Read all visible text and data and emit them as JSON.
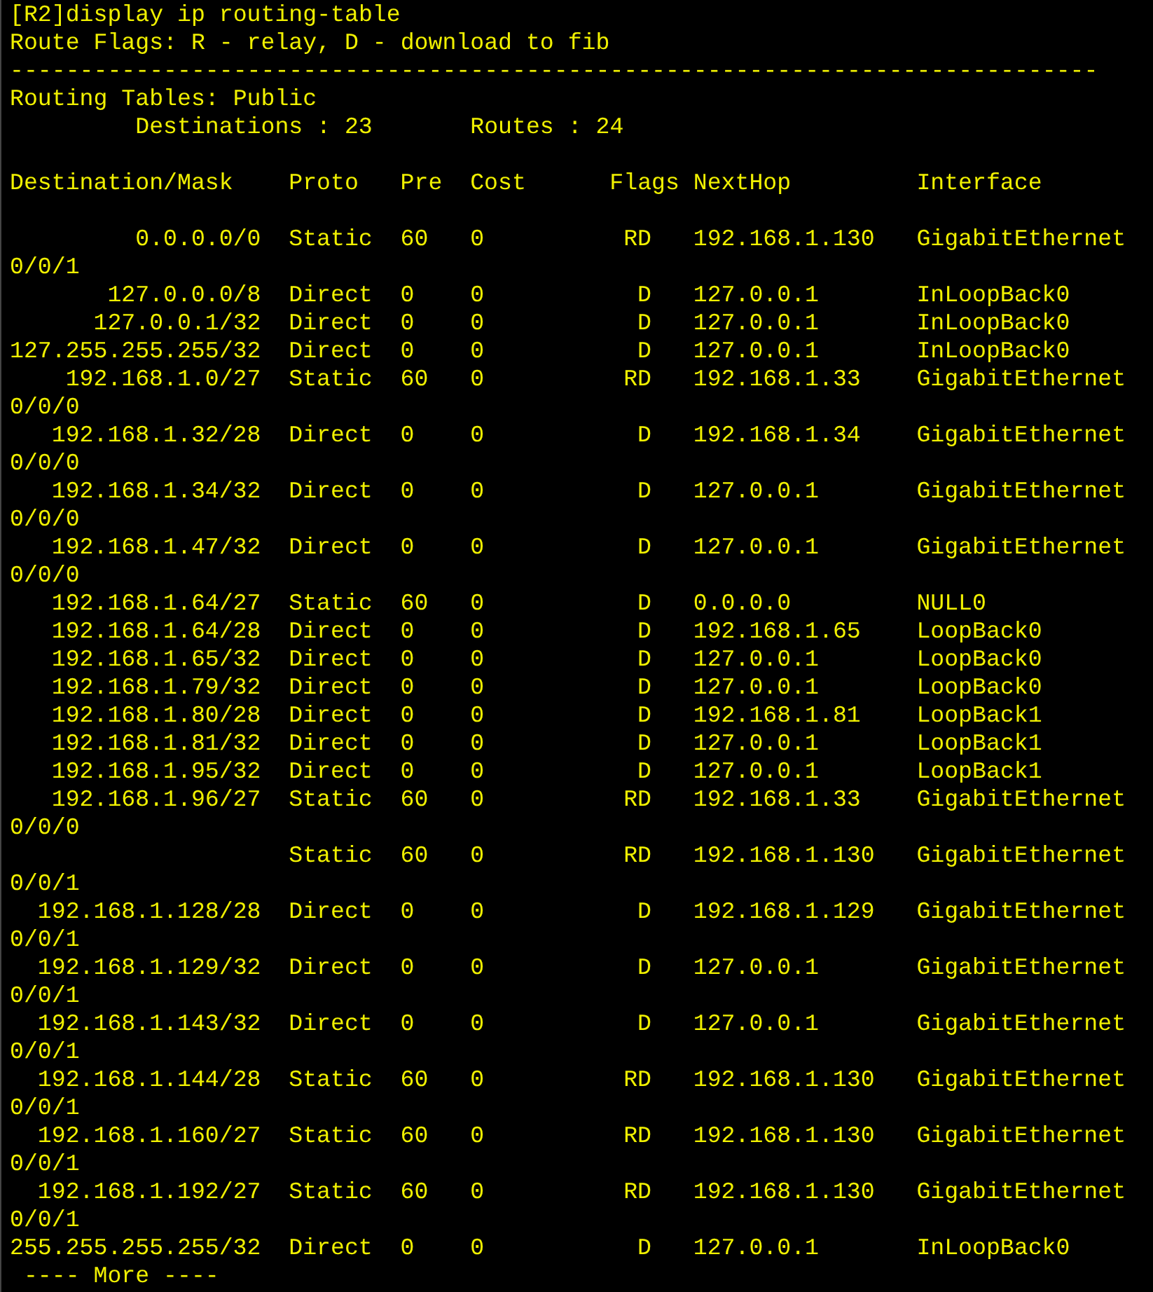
{
  "command": "[R2]display ip routing-table",
  "route_flags": "Route Flags: R - relay, D - download to fib",
  "separator": "------------------------------------------------------------------------------",
  "table_title": "Routing Tables: Public",
  "summary": {
    "destinations_label": "Destinations : 23",
    "routes_label": "Routes : 24"
  },
  "columns": [
    "Destination/Mask",
    "Proto",
    "Pre",
    "Cost",
    "Flags",
    "NextHop",
    "Interface"
  ],
  "rows": [
    {
      "destination": "0.0.0.0/0",
      "proto": "Static",
      "pre": "60",
      "cost": "0",
      "flags": "RD",
      "nexthop": "192.168.1.130",
      "interface": "GigabitEthernet",
      "interface_wrap": "0/0/1"
    },
    {
      "destination": "127.0.0.0/8",
      "proto": "Direct",
      "pre": "0",
      "cost": "0",
      "flags": "D",
      "nexthop": "127.0.0.1",
      "interface": "InLoopBack0"
    },
    {
      "destination": "127.0.0.1/32",
      "proto": "Direct",
      "pre": "0",
      "cost": "0",
      "flags": "D",
      "nexthop": "127.0.0.1",
      "interface": "InLoopBack0"
    },
    {
      "destination": "127.255.255.255/32",
      "proto": "Direct",
      "pre": "0",
      "cost": "0",
      "flags": "D",
      "nexthop": "127.0.0.1",
      "interface": "InLoopBack0"
    },
    {
      "destination": "192.168.1.0/27",
      "proto": "Static",
      "pre": "60",
      "cost": "0",
      "flags": "RD",
      "nexthop": "192.168.1.33",
      "interface": "GigabitEthernet",
      "interface_wrap": "0/0/0"
    },
    {
      "destination": "192.168.1.32/28",
      "proto": "Direct",
      "pre": "0",
      "cost": "0",
      "flags": "D",
      "nexthop": "192.168.1.34",
      "interface": "GigabitEthernet",
      "interface_wrap": "0/0/0"
    },
    {
      "destination": "192.168.1.34/32",
      "proto": "Direct",
      "pre": "0",
      "cost": "0",
      "flags": "D",
      "nexthop": "127.0.0.1",
      "interface": "GigabitEthernet",
      "interface_wrap": "0/0/0"
    },
    {
      "destination": "192.168.1.47/32",
      "proto": "Direct",
      "pre": "0",
      "cost": "0",
      "flags": "D",
      "nexthop": "127.0.0.1",
      "interface": "GigabitEthernet",
      "interface_wrap": "0/0/0"
    },
    {
      "destination": "192.168.1.64/27",
      "proto": "Static",
      "pre": "60",
      "cost": "0",
      "flags": "D",
      "nexthop": "0.0.0.0",
      "interface": "NULL0"
    },
    {
      "destination": "192.168.1.64/28",
      "proto": "Direct",
      "pre": "0",
      "cost": "0",
      "flags": "D",
      "nexthop": "192.168.1.65",
      "interface": "LoopBack0"
    },
    {
      "destination": "192.168.1.65/32",
      "proto": "Direct",
      "pre": "0",
      "cost": "0",
      "flags": "D",
      "nexthop": "127.0.0.1",
      "interface": "LoopBack0"
    },
    {
      "destination": "192.168.1.79/32",
      "proto": "Direct",
      "pre": "0",
      "cost": "0",
      "flags": "D",
      "nexthop": "127.0.0.1",
      "interface": "LoopBack0"
    },
    {
      "destination": "192.168.1.80/28",
      "proto": "Direct",
      "pre": "0",
      "cost": "0",
      "flags": "D",
      "nexthop": "192.168.1.81",
      "interface": "LoopBack1"
    },
    {
      "destination": "192.168.1.81/32",
      "proto": "Direct",
      "pre": "0",
      "cost": "0",
      "flags": "D",
      "nexthop": "127.0.0.1",
      "interface": "LoopBack1"
    },
    {
      "destination": "192.168.1.95/32",
      "proto": "Direct",
      "pre": "0",
      "cost": "0",
      "flags": "D",
      "nexthop": "127.0.0.1",
      "interface": "LoopBack1"
    },
    {
      "destination": "192.168.1.96/27",
      "proto": "Static",
      "pre": "60",
      "cost": "0",
      "flags": "RD",
      "nexthop": "192.168.1.33",
      "interface": "GigabitEthernet",
      "interface_wrap": "0/0/0"
    },
    {
      "proto": "Static",
      "pre": "60",
      "cost": "0",
      "flags": "RD",
      "nexthop": "192.168.1.130",
      "interface": "GigabitEthernet",
      "interface_wrap": "0/0/1"
    },
    {
      "destination": "192.168.1.128/28",
      "proto": "Direct",
      "pre": "0",
      "cost": "0",
      "flags": "D",
      "nexthop": "192.168.1.129",
      "interface": "GigabitEthernet",
      "interface_wrap": "0/0/1"
    },
    {
      "destination": "192.168.1.129/32",
      "proto": "Direct",
      "pre": "0",
      "cost": "0",
      "flags": "D",
      "nexthop": "127.0.0.1",
      "interface": "GigabitEthernet",
      "interface_wrap": "0/0/1"
    },
    {
      "destination": "192.168.1.143/32",
      "proto": "Direct",
      "pre": "0",
      "cost": "0",
      "flags": "D",
      "nexthop": "127.0.0.1",
      "interface": "GigabitEthernet",
      "interface_wrap": "0/0/1"
    },
    {
      "destination": "192.168.1.144/28",
      "proto": "Static",
      "pre": "60",
      "cost": "0",
      "flags": "RD",
      "nexthop": "192.168.1.130",
      "interface": "GigabitEthernet",
      "interface_wrap": "0/0/1"
    },
    {
      "destination": "192.168.1.160/27",
      "proto": "Static",
      "pre": "60",
      "cost": "0",
      "flags": "RD",
      "nexthop": "192.168.1.130",
      "interface": "GigabitEthernet",
      "interface_wrap": "0/0/1"
    },
    {
      "destination": "192.168.1.192/27",
      "proto": "Static",
      "pre": "60",
      "cost": "0",
      "flags": "RD",
      "nexthop": "192.168.1.130",
      "interface": "GigabitEthernet",
      "interface_wrap": "0/0/1"
    },
    {
      "destination": "255.255.255.255/32",
      "proto": "Direct",
      "pre": "0",
      "cost": "0",
      "flags": "D",
      "nexthop": "127.0.0.1",
      "interface": "InLoopBack0"
    }
  ],
  "more_prompt": "---- More ----"
}
